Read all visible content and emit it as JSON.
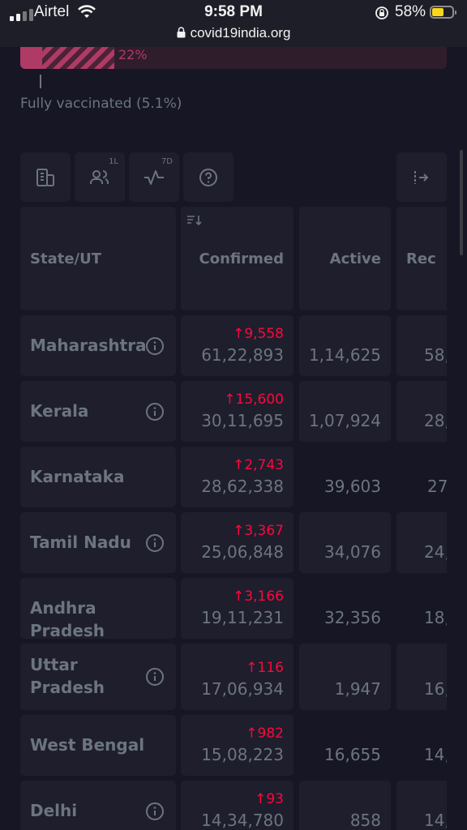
{
  "status_bar": {
    "carrier": "Airtel",
    "time": "9:58 PM",
    "battery": "58%",
    "battery_level": 0.58,
    "url": "covid19india.org",
    "icons": [
      "signal-icon",
      "wifi-icon",
      "orientation-lock-icon",
      "battery-icon",
      "padlock-icon"
    ]
  },
  "vaccination": {
    "partial_percent_label": "22%",
    "partial_fraction": 0.22,
    "full_fraction": 0.051,
    "fully_label": "Fully vaccinated (5.1%)"
  },
  "toolbar": {
    "buttons": [
      {
        "icon": "building-icon",
        "sup": ""
      },
      {
        "icon": "users-icon",
        "sup": "1L"
      },
      {
        "icon": "pulse-icon",
        "sup": "7D"
      },
      {
        "icon": "help-icon",
        "sup": ""
      }
    ],
    "expand_icon": "expand-columns-icon"
  },
  "table": {
    "headers": {
      "state": "State/UT",
      "confirmed": "Confirmed",
      "active": "Active",
      "recovered": "Rec"
    },
    "rows": [
      {
        "state": "Maharashtra",
        "info": true,
        "delta_confirmed": "↑9,558",
        "confirmed": "61,22,893",
        "active": "1,14,625",
        "recovered": "58,"
      },
      {
        "state": "Kerala",
        "info": true,
        "delta_confirmed": "↑15,600",
        "confirmed": "30,11,695",
        "active": "1,07,924",
        "recovered": "28,"
      },
      {
        "state": "Karnataka",
        "info": false,
        "delta_confirmed": "↑2,743",
        "confirmed": "28,62,338",
        "active": "39,603",
        "recovered": "27"
      },
      {
        "state": "Tamil Nadu",
        "info": true,
        "delta_confirmed": "↑3,367",
        "confirmed": "25,06,848",
        "active": "34,076",
        "recovered": "24,"
      },
      {
        "state": "Andhra Pradesh",
        "info": false,
        "delta_confirmed": "↑3,166",
        "confirmed": "19,11,231",
        "active": "32,356",
        "recovered": "18,"
      },
      {
        "state_line1": "Uttar",
        "state_line2": "Pradesh",
        "info": true,
        "delta_confirmed": "↑116",
        "confirmed": "17,06,934",
        "active": "1,947",
        "recovered": "16,"
      },
      {
        "state": "West Bengal",
        "info": false,
        "delta_confirmed": "↑982",
        "confirmed": "15,08,223",
        "active": "16,655",
        "recovered": "14,"
      },
      {
        "state": "Delhi",
        "info": true,
        "delta_confirmed": "↑93",
        "confirmed": "14,34,780",
        "active": "858",
        "recovered": "14,"
      }
    ]
  },
  "colors": {
    "background": "#161625",
    "cell": "#1e1e2d",
    "text_muted": "#6c757d",
    "confirmed_delta": "#ff073a",
    "vaccine": "#b03a66"
  }
}
